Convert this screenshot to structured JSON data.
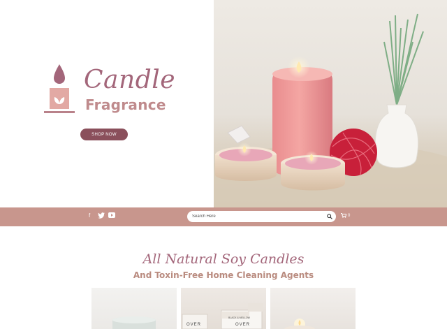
{
  "brand": {
    "line1": "Candle",
    "line2": "Fragrance"
  },
  "hero": {
    "shop_button": "SHOP NOW"
  },
  "social": {
    "facebook": "f",
    "twitter": "twitter-icon",
    "youtube": "youtube-icon"
  },
  "search": {
    "placeholder": "Search Here"
  },
  "cart": {
    "count": "0"
  },
  "section": {
    "title": "All Natural Soy Candles",
    "subtitle": "And Toxin-Free Home Cleaning Agents"
  },
  "products": [
    {
      "label": ""
    },
    {
      "label_top": "BLACK & MELLOW",
      "label_left": "OVER",
      "label_right": "OVER"
    },
    {
      "label": ""
    }
  ],
  "colors": {
    "accent": "#a3667a",
    "bar": "#c8968d",
    "button": "#8a4f5b",
    "secondary": "#bf8a8c"
  }
}
